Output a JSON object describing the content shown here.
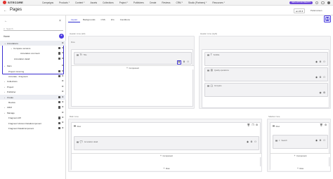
{
  "topnav": {
    "brand": "SITECORE",
    "items": [
      "Campaigns",
      "Products",
      "Content",
      "Assets",
      "Collections",
      "Project",
      "Publishers",
      "Create",
      "Reviews",
      "CRM",
      "Studio (Partners)",
      "Resources"
    ],
    "env_badge": "NEW APPOINTMENTS"
  },
  "header": {
    "title": "Pages",
    "language": "en-US",
    "portal_label": "Portal screen"
  },
  "sidebar": {
    "search_placeholder": "Search",
    "home_label": "Home",
    "tree": [
      {
        "label": "Annotations",
        "level": 0,
        "expanded": true,
        "highlighted": true
      },
      {
        "label": "Compare versions",
        "level": 1,
        "expanded": true
      },
      {
        "label": "Annotation comment",
        "level": 2
      },
      {
        "label": "Annotation detail",
        "level": 1
      },
      {
        "label": "Main",
        "level": 0
      },
      {
        "label": "Project incoming",
        "level": 0
      },
      {
        "label": "Annotate - Fragment",
        "level": 0
      },
      {
        "label": "Collections",
        "level": 0
      },
      {
        "label": "Project",
        "level": 0
      },
      {
        "label": "Publisher",
        "level": 0
      },
      {
        "label": "Create",
        "level": 0,
        "highlighted": true
      },
      {
        "label": "Review",
        "level": 0
      },
      {
        "label": "CRM",
        "level": 0
      },
      {
        "label": "Manage",
        "level": 0
      },
      {
        "label": "Fragment diff",
        "level": 0
      },
      {
        "label": "Fragment Version Detailcomponent",
        "level": 0
      },
      {
        "label": "Fragment Detailcomponent",
        "level": 0
      }
    ]
  },
  "tabs": [
    "Layout",
    "Backgrounds",
    "CSS",
    "Info",
    "Conditions"
  ],
  "main": {
    "header_zone_left": "Header zone (left)",
    "header_zone_right": "Header zone (right)",
    "main_zone": "Main zone",
    "sidebar_zone": "Sidebar zone",
    "row_label": "Row",
    "title_label": "Title",
    "subtitle_label": "Subtitle",
    "quality_label": "Quality operations",
    "compare_label": "Compare",
    "annotation_detail": "Annotation detail",
    "search_label": "Search",
    "add_component": "Component",
    "add_row": "Row"
  }
}
